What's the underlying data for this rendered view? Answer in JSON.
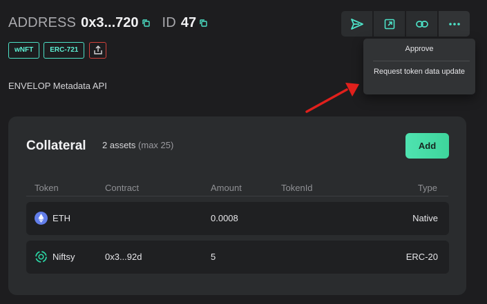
{
  "header": {
    "address_label": "ADDRESS",
    "address_value": "0x3...720",
    "id_label": "ID",
    "id_value": "47"
  },
  "badges": [
    "wNFT",
    "ERC-721"
  ],
  "subtitle": "ENVELOP Metadata API",
  "toolbar": {
    "icons": [
      "send-icon",
      "external-link-icon",
      "link-icon",
      "more-icon"
    ]
  },
  "dropdown": {
    "items": [
      "Approve",
      "Request token data update"
    ]
  },
  "collateral": {
    "title": "Collateral",
    "count": "2 assets",
    "max": "(max 25)",
    "add_label": "Add",
    "columns": [
      "Token",
      "Contract",
      "Amount",
      "TokenId",
      "Type"
    ],
    "rows": [
      {
        "token": "ETH",
        "contract": "",
        "amount": "0.0008",
        "tokenid": "",
        "type": "Native",
        "icon": "eth-icon"
      },
      {
        "token": "Niftsy",
        "contract": "0x3...92d",
        "amount": "5",
        "tokenid": "",
        "type": "ERC-20",
        "icon": "niftsy-icon"
      }
    ]
  },
  "colors": {
    "accent": "#4de3c8",
    "add_button": "#4fe3b0",
    "alert_red": "#d2423c",
    "background": "#1d1d1f",
    "card": "#2a2c2e"
  }
}
